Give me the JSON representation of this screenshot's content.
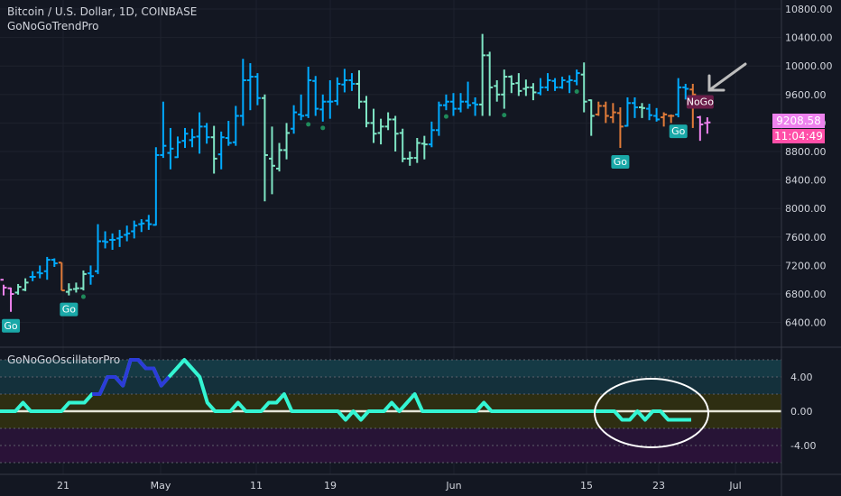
{
  "header": {
    "title": "Bitcoin / U.S. Dollar, 1D, COINBASE",
    "indicator": "GoNoGoTrendPro"
  },
  "oscillator_panel": {
    "title": "GoNoGoOscillatorPro"
  },
  "price_axis": {
    "ticks": [
      "10800.00",
      "10400.00",
      "10000.00",
      "9600.00",
      "9200.00",
      "8800.00",
      "8400.00",
      "8000.00",
      "7600.00",
      "7200.00",
      "6800.00",
      "6400.00"
    ],
    "current_price": "9208.58",
    "countdown": "11:04:49"
  },
  "osc_axis": {
    "ticks": [
      "4.00",
      "0.00",
      "-4.00"
    ]
  },
  "time_axis": {
    "ticks": [
      "21",
      "May",
      "11",
      "19",
      "Jun",
      "15",
      "23",
      "Jul"
    ]
  },
  "signals": {
    "go": "Go",
    "nogo": "NoGo"
  },
  "colors": {
    "background": "#131722",
    "strong_go": "#00aaff",
    "weak_go": "#7fe6c5",
    "nogo_weak": "#e07b39",
    "nogo_strong": "#ee82ee",
    "go_label_bg": "#1aa8a8",
    "nogo_label_bg": "#6b1e4a",
    "osc_line": "#34f5d3",
    "osc_strong": "#2c3bd9",
    "countdown_bg": "#ff4fa8"
  },
  "chart_data": {
    "type": "bar",
    "series": [
      {
        "name": "BTCUSD",
        "bars": [
          [
            0,
            "n",
            7000,
            6930,
            6780,
            6890
          ],
          [
            1,
            "n",
            6880,
            6890,
            6550,
            6800
          ],
          [
            2,
            "w",
            6820,
            6940,
            6790,
            6900
          ],
          [
            3,
            "w",
            6860,
            7020,
            6840,
            6960
          ],
          [
            4,
            "s",
            7040,
            7120,
            6980,
            7040
          ],
          [
            5,
            "s",
            7100,
            7200,
            7020,
            7090
          ],
          [
            6,
            "s",
            7120,
            7320,
            7000,
            7280
          ],
          [
            7,
            "s",
            7280,
            7300,
            7180,
            7230
          ],
          [
            8,
            "o",
            7240,
            7240,
            6850,
            6850
          ],
          [
            9,
            "w",
            6830,
            6950,
            6780,
            6860
          ],
          [
            10,
            "w",
            6870,
            6960,
            6820,
            6880
          ],
          [
            11,
            "w",
            6880,
            7130,
            6850,
            7080
          ],
          [
            12,
            "s",
            7090,
            7200,
            6930,
            7050
          ],
          [
            13,
            "s",
            7120,
            7780,
            7080,
            7540
          ],
          [
            14,
            "s",
            7540,
            7680,
            7440,
            7530
          ],
          [
            15,
            "s",
            7560,
            7650,
            7420,
            7560
          ],
          [
            16,
            "s",
            7580,
            7700,
            7460,
            7600
          ],
          [
            17,
            "s",
            7630,
            7760,
            7540,
            7650
          ],
          [
            18,
            "s",
            7680,
            7830,
            7580,
            7760
          ],
          [
            19,
            "s",
            7780,
            7850,
            7670,
            7790
          ],
          [
            20,
            "s",
            7830,
            7910,
            7700,
            7780
          ],
          [
            21,
            "s",
            7770,
            8860,
            7760,
            8750
          ],
          [
            22,
            "s",
            8750,
            9500,
            8710,
            8880
          ],
          [
            23,
            "s",
            8780,
            9130,
            8550,
            8840
          ],
          [
            24,
            "s",
            8720,
            9010,
            8710,
            8930
          ],
          [
            25,
            "s",
            8950,
            9130,
            8850,
            9050
          ],
          [
            26,
            "s",
            8960,
            9120,
            8860,
            9000
          ],
          [
            27,
            "s",
            9010,
            9350,
            8770,
            9150
          ],
          [
            28,
            "s",
            9150,
            9200,
            8910,
            9000
          ],
          [
            29,
            "w",
            9000,
            9160,
            8490,
            8700
          ],
          [
            30,
            "s",
            8760,
            9080,
            8550,
            9000
          ],
          [
            31,
            "s",
            8990,
            9230,
            8880,
            8920
          ],
          [
            32,
            "s",
            8930,
            9440,
            8880,
            9300
          ],
          [
            33,
            "s",
            9300,
            10100,
            9160,
            9800
          ],
          [
            34,
            "s",
            9800,
            10040,
            9380,
            9850
          ],
          [
            35,
            "s",
            9850,
            9900,
            9450,
            9550
          ],
          [
            36,
            "w",
            9550,
            9600,
            8100,
            8750
          ],
          [
            37,
            "w",
            8700,
            9150,
            8200,
            8600
          ],
          [
            38,
            "w",
            8560,
            8920,
            8520,
            8820
          ],
          [
            39,
            "w",
            8820,
            9200,
            8690,
            9060
          ],
          [
            40,
            "s",
            9120,
            9450,
            9050,
            9350
          ],
          [
            41,
            "s",
            9320,
            9600,
            9240,
            9300
          ],
          [
            42,
            "s",
            9310,
            9990,
            9270,
            9800
          ],
          [
            43,
            "s",
            9790,
            9860,
            9300,
            9400
          ],
          [
            44,
            "s",
            9390,
            9600,
            9220,
            9500
          ],
          [
            45,
            "s",
            9500,
            9800,
            9260,
            9500
          ],
          [
            46,
            "s",
            9510,
            9840,
            9450,
            9750
          ],
          [
            47,
            "s",
            9740,
            9960,
            9630,
            9800
          ],
          [
            48,
            "s",
            9800,
            9900,
            9650,
            9750
          ],
          [
            49,
            "w",
            9750,
            9940,
            9400,
            9500
          ],
          [
            50,
            "w",
            9500,
            9580,
            9140,
            9200
          ],
          [
            51,
            "w",
            9200,
            9400,
            8920,
            9050
          ],
          [
            52,
            "w",
            9060,
            9260,
            8900,
            9150
          ],
          [
            53,
            "w",
            9150,
            9350,
            9100,
            9250
          ],
          [
            54,
            "w",
            9250,
            9300,
            8800,
            9050
          ],
          [
            55,
            "w",
            9060,
            9120,
            8650,
            8700
          ],
          [
            56,
            "w",
            8700,
            8800,
            8600,
            8710
          ],
          [
            57,
            "w",
            8710,
            8990,
            8640,
            8920
          ],
          [
            58,
            "w",
            8910,
            9020,
            8690,
            8900
          ],
          [
            59,
            "s",
            8900,
            9220,
            8860,
            9100
          ],
          [
            60,
            "s",
            9100,
            9500,
            9020,
            9450
          ],
          [
            61,
            "s",
            9450,
            9600,
            9380,
            9500
          ],
          [
            62,
            "s",
            9500,
            9620,
            9300,
            9400
          ],
          [
            63,
            "s",
            9400,
            9620,
            9350,
            9500
          ],
          [
            64,
            "s",
            9500,
            9780,
            9400,
            9450
          ],
          [
            65,
            "s",
            9480,
            9560,
            9300,
            9460
          ],
          [
            66,
            "w",
            9460,
            10450,
            9300,
            10150
          ],
          [
            67,
            "w",
            10150,
            10200,
            9300,
            9700
          ],
          [
            68,
            "w",
            9720,
            9800,
            9500,
            9600
          ],
          [
            69,
            "w",
            9600,
            9950,
            9400,
            9850
          ],
          [
            70,
            "w",
            9850,
            9870,
            9620,
            9750
          ],
          [
            71,
            "w",
            9760,
            9900,
            9580,
            9650
          ],
          [
            72,
            "w",
            9680,
            9810,
            9580,
            9700
          ],
          [
            73,
            "w",
            9700,
            9760,
            9520,
            9630
          ],
          [
            74,
            "s",
            9620,
            9830,
            9590,
            9700
          ],
          [
            75,
            "s",
            9700,
            9900,
            9650,
            9800
          ],
          [
            76,
            "s",
            9790,
            9830,
            9650,
            9700
          ],
          [
            77,
            "s",
            9700,
            9850,
            9680,
            9800
          ],
          [
            78,
            "s",
            9780,
            9870,
            9620,
            9800
          ],
          [
            79,
            "s",
            9790,
            9950,
            9730,
            9900
          ],
          [
            80,
            "w",
            9880,
            10050,
            9350,
            9500
          ],
          [
            81,
            "w",
            9520,
            9530,
            9020,
            9300
          ],
          [
            82,
            "o",
            9320,
            9500,
            9300,
            9440
          ],
          [
            83,
            "o",
            9440,
            9500,
            9200,
            9300
          ],
          [
            84,
            "o",
            9280,
            9480,
            9200,
            9350
          ],
          [
            85,
            "o",
            9340,
            9420,
            8850,
            9150
          ],
          [
            86,
            "s",
            9160,
            9560,
            9150,
            9480
          ],
          [
            87,
            "s",
            9480,
            9560,
            9270,
            9420
          ],
          [
            88,
            "w",
            9420,
            9480,
            9270,
            9410
          ],
          [
            89,
            "s",
            9400,
            9470,
            9240,
            9310
          ],
          [
            90,
            "s",
            9300,
            9410,
            9220,
            9250
          ],
          [
            91,
            "o",
            9280,
            9350,
            9150,
            9320
          ],
          [
            92,
            "o",
            9300,
            9320,
            9200,
            9300
          ],
          [
            93,
            "s",
            9320,
            9830,
            9280,
            9700
          ],
          [
            94,
            "s",
            9700,
            9750,
            9530,
            9680
          ],
          [
            95,
            "o",
            9670,
            9750,
            9130,
            9600
          ],
          [
            96,
            "n",
            9280,
            9300,
            8950,
            9180
          ],
          [
            97,
            "n",
            9200,
            9280,
            9050,
            9208
          ]
        ]
      }
    ],
    "go_dots": [
      11,
      42,
      44,
      61,
      69,
      79
    ],
    "signals": [
      {
        "bar": 1,
        "label": "Go",
        "side": "below"
      },
      {
        "bar": 9,
        "label": "Go",
        "side": "below"
      },
      {
        "bar": 85,
        "label": "Go",
        "side": "below"
      },
      {
        "bar": 93,
        "label": "Go",
        "side": "below"
      },
      {
        "bar": 96,
        "label": "NoGo",
        "side": "above"
      }
    ],
    "oscillator": {
      "values": [
        0,
        0,
        0,
        1,
        0,
        0,
        0,
        0,
        0,
        1,
        1,
        1,
        2,
        2,
        4,
        4,
        3,
        6,
        6,
        5,
        5,
        3,
        4,
        5,
        6,
        5,
        4,
        1,
        0,
        0,
        0,
        1,
        0,
        0,
        0,
        1,
        1,
        2,
        0,
        0,
        0,
        0,
        0,
        0,
        0,
        -1,
        0,
        -1,
        0,
        0,
        0,
        1,
        0,
        1,
        2,
        0,
        0,
        0,
        0,
        0,
        0,
        0,
        0,
        1,
        0,
        0,
        0,
        0,
        0,
        0,
        0,
        0,
        0,
        0,
        0,
        0,
        0,
        0,
        0,
        0,
        0,
        -1,
        -1,
        0,
        -1,
        0,
        0,
        -1,
        -1,
        -1,
        -1
      ],
      "strong_range": [
        12,
        22
      ],
      "ylim": [
        -6,
        6
      ]
    }
  }
}
